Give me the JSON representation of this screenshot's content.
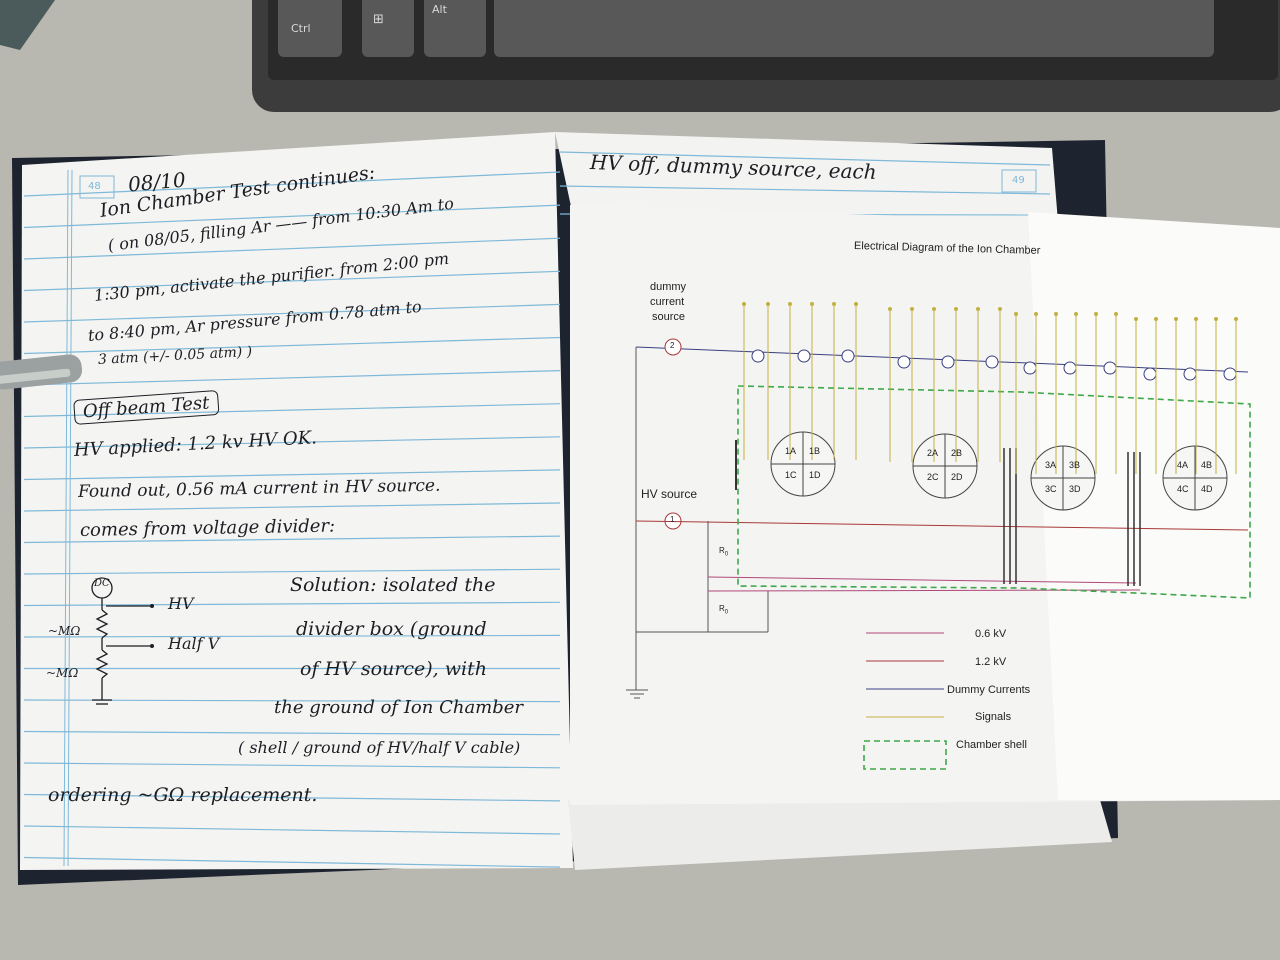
{
  "keyboard": {
    "keys": [
      "Ctrl",
      "⊞",
      "Alt"
    ]
  },
  "notebook_left": {
    "page_number": "48",
    "date": "08/10",
    "lines": [
      "Ion Chamber Test continues:",
      "( on 08/05, filling Ar —— from 10:30 Am to",
      "1:30 pm, activate the purifier. from 2:00 pm",
      "to 8:40 pm, Ar pressure from 0.78 atm to",
      "3 atm (+/- 0.05 atm) )",
      "Off beam Test",
      "HV applied: 1.2 kv HV OK.",
      "Found out, 0.56 mA current in HV source.",
      "comes from voltage divider:",
      "Solution: isolated the",
      "divider box (ground",
      "of HV source), with",
      "the ground of Ion Chamber",
      "( shell / ground of HV/half V cable)",
      "ordering ~GΩ replacement."
    ],
    "sketch": {
      "source_label": "DC",
      "hv_label": "HV",
      "half_label": "Half V",
      "r1": "~MΩ",
      "r2": "~MΩ"
    }
  },
  "notebook_right": {
    "page_number": "49",
    "top_line": "HV off, dummy source, each"
  },
  "diagram": {
    "title": "Electrical Diagram of the Ion Chamber",
    "dummy_label_1": "dummy",
    "dummy_label_2": "current",
    "dummy_label_3": "source",
    "dummy_num": "2",
    "hv_label": "HV source",
    "hv_num": "1",
    "r_label": "R",
    "r_sub": "0",
    "chambers": [
      [
        "1A",
        "1B",
        "1C",
        "1D"
      ],
      [
        "2A",
        "2B",
        "2C",
        "2D"
      ],
      [
        "3A",
        "3B",
        "3C",
        "3D"
      ],
      [
        "4A",
        "4B",
        "4C",
        "4D"
      ]
    ],
    "legend": [
      {
        "label": "0.6 kV",
        "color": "#b0487a",
        "dash": false
      },
      {
        "label": "1.2 kV",
        "color": "#a83838",
        "dash": false
      },
      {
        "label": "Dummy Currents",
        "color": "#3a3f80",
        "dash": false
      },
      {
        "label": "Signals",
        "color": "#c4b040",
        "dash": false
      },
      {
        "label": "Chamber shell",
        "color": "#3ea84a",
        "dash": true
      }
    ]
  }
}
